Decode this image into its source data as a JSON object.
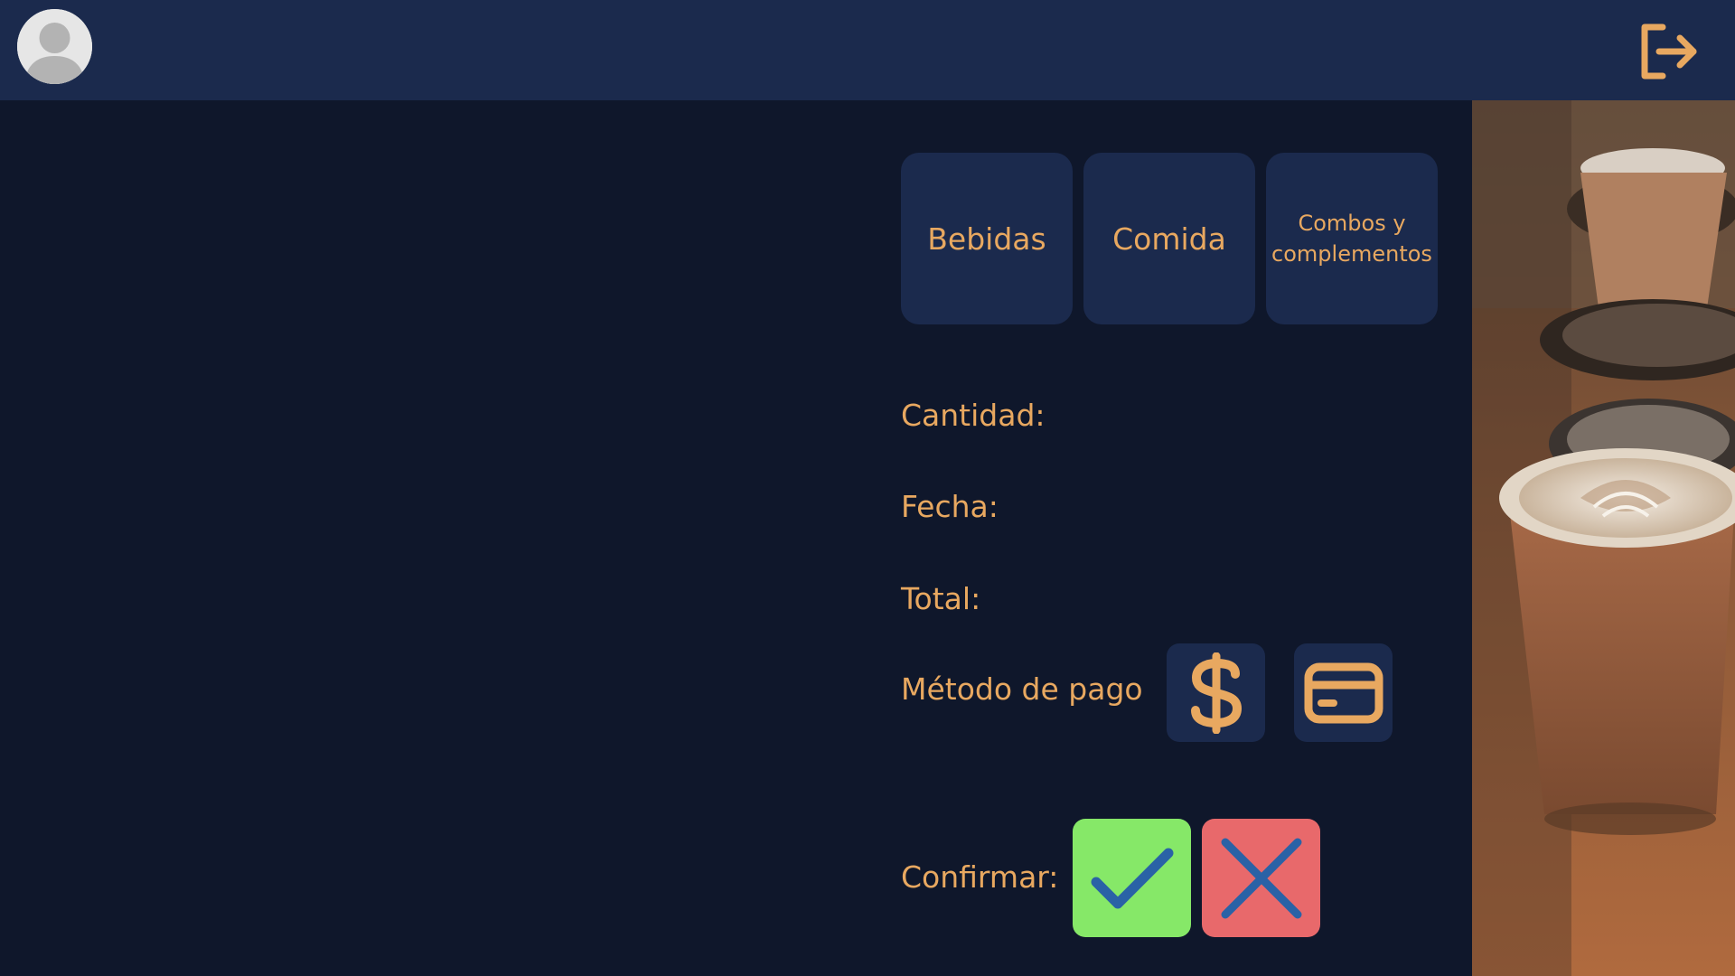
{
  "header": {
    "avatar_icon": "user-avatar-icon",
    "logout_icon": "logout-icon"
  },
  "categories": [
    {
      "label": "Bebidas"
    },
    {
      "label": "Comida"
    },
    {
      "label": "Combos y complementos"
    }
  ],
  "order": {
    "quantity_label": "Cantidad:",
    "date_label": "Fecha:",
    "total_label": "Total:",
    "payment_method_label": "Método de pago",
    "payment_options": [
      {
        "icon": "dollar-icon"
      },
      {
        "icon": "credit-card-icon"
      }
    ],
    "confirm_label": "Confirmar:",
    "confirm_icon": "check-icon",
    "cancel_icon": "close-icon"
  },
  "colors": {
    "header_bg": "#1b2a4d",
    "page_bg": "#0f172b",
    "accent": "#e8a860",
    "confirm_bg": "#86e868",
    "cancel_bg": "#e8696b",
    "icon_blue": "#2a62a6"
  }
}
